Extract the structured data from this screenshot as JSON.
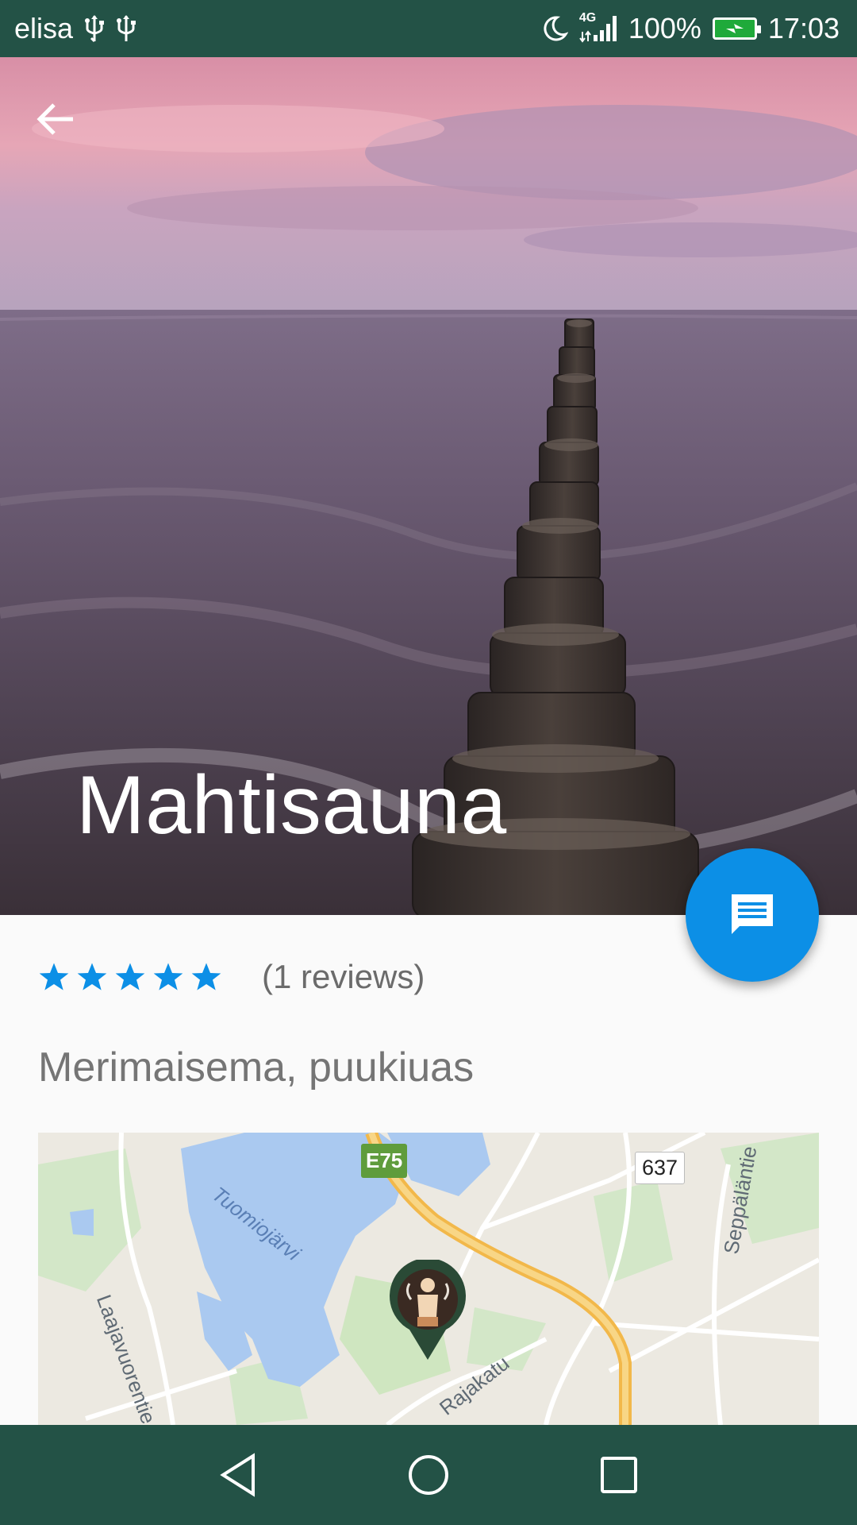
{
  "status_bar": {
    "carrier": "elisa",
    "network": "4G",
    "battery_percent": "100%",
    "time": "17:03",
    "icons": [
      "usb-icon",
      "usb-icon",
      "moon-icon",
      "signal-icon",
      "battery-charging-icon"
    ]
  },
  "header": {
    "back_icon": "arrow-back-icon",
    "title": "Mahtisauna"
  },
  "fab": {
    "icon": "message-icon"
  },
  "rating": {
    "stars": 5,
    "max_stars": 5,
    "star_color": "#0c8fe6",
    "reviews_text": "(1 reviews)"
  },
  "description": "Merimaisema, puukiuas",
  "map": {
    "lake_label": "Tuomiojärvi",
    "road_labels": [
      "Laajavuorentie",
      "Seppäläntie",
      "Rajakatu"
    ],
    "road_shields": [
      "E75",
      "637"
    ],
    "marker_icon": "sauna-marker-icon"
  },
  "nav_bar": {
    "icons": [
      "nav-back-icon",
      "nav-home-icon",
      "nav-recents-icon"
    ]
  },
  "colors": {
    "system_bars": "#235246",
    "accent": "#0c8fe6"
  }
}
